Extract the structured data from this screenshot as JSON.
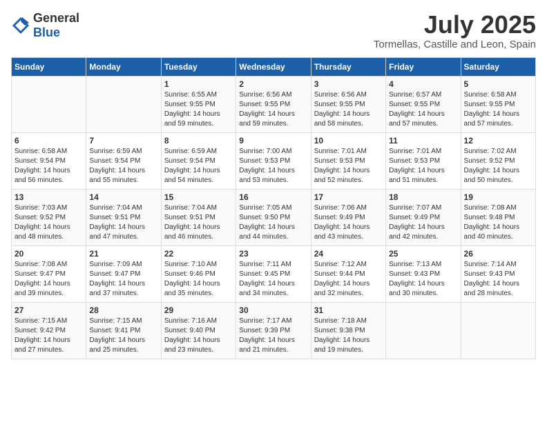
{
  "logo": {
    "general": "General",
    "blue": "Blue"
  },
  "title": "July 2025",
  "subtitle": "Tormellas, Castille and Leon, Spain",
  "days": [
    "Sunday",
    "Monday",
    "Tuesday",
    "Wednesday",
    "Thursday",
    "Friday",
    "Saturday"
  ],
  "weeks": [
    [
      {
        "day": "",
        "sunrise": "",
        "sunset": "",
        "daylight": ""
      },
      {
        "day": "",
        "sunrise": "",
        "sunset": "",
        "daylight": ""
      },
      {
        "day": "1",
        "sunrise": "Sunrise: 6:55 AM",
        "sunset": "Sunset: 9:55 PM",
        "daylight": "Daylight: 14 hours and 59 minutes."
      },
      {
        "day": "2",
        "sunrise": "Sunrise: 6:56 AM",
        "sunset": "Sunset: 9:55 PM",
        "daylight": "Daylight: 14 hours and 59 minutes."
      },
      {
        "day": "3",
        "sunrise": "Sunrise: 6:56 AM",
        "sunset": "Sunset: 9:55 PM",
        "daylight": "Daylight: 14 hours and 58 minutes."
      },
      {
        "day": "4",
        "sunrise": "Sunrise: 6:57 AM",
        "sunset": "Sunset: 9:55 PM",
        "daylight": "Daylight: 14 hours and 57 minutes."
      },
      {
        "day": "5",
        "sunrise": "Sunrise: 6:58 AM",
        "sunset": "Sunset: 9:55 PM",
        "daylight": "Daylight: 14 hours and 57 minutes."
      }
    ],
    [
      {
        "day": "6",
        "sunrise": "Sunrise: 6:58 AM",
        "sunset": "Sunset: 9:54 PM",
        "daylight": "Daylight: 14 hours and 56 minutes."
      },
      {
        "day": "7",
        "sunrise": "Sunrise: 6:59 AM",
        "sunset": "Sunset: 9:54 PM",
        "daylight": "Daylight: 14 hours and 55 minutes."
      },
      {
        "day": "8",
        "sunrise": "Sunrise: 6:59 AM",
        "sunset": "Sunset: 9:54 PM",
        "daylight": "Daylight: 14 hours and 54 minutes."
      },
      {
        "day": "9",
        "sunrise": "Sunrise: 7:00 AM",
        "sunset": "Sunset: 9:53 PM",
        "daylight": "Daylight: 14 hours and 53 minutes."
      },
      {
        "day": "10",
        "sunrise": "Sunrise: 7:01 AM",
        "sunset": "Sunset: 9:53 PM",
        "daylight": "Daylight: 14 hours and 52 minutes."
      },
      {
        "day": "11",
        "sunrise": "Sunrise: 7:01 AM",
        "sunset": "Sunset: 9:53 PM",
        "daylight": "Daylight: 14 hours and 51 minutes."
      },
      {
        "day": "12",
        "sunrise": "Sunrise: 7:02 AM",
        "sunset": "Sunset: 9:52 PM",
        "daylight": "Daylight: 14 hours and 50 minutes."
      }
    ],
    [
      {
        "day": "13",
        "sunrise": "Sunrise: 7:03 AM",
        "sunset": "Sunset: 9:52 PM",
        "daylight": "Daylight: 14 hours and 48 minutes."
      },
      {
        "day": "14",
        "sunrise": "Sunrise: 7:04 AM",
        "sunset": "Sunset: 9:51 PM",
        "daylight": "Daylight: 14 hours and 47 minutes."
      },
      {
        "day": "15",
        "sunrise": "Sunrise: 7:04 AM",
        "sunset": "Sunset: 9:51 PM",
        "daylight": "Daylight: 14 hours and 46 minutes."
      },
      {
        "day": "16",
        "sunrise": "Sunrise: 7:05 AM",
        "sunset": "Sunset: 9:50 PM",
        "daylight": "Daylight: 14 hours and 44 minutes."
      },
      {
        "day": "17",
        "sunrise": "Sunrise: 7:06 AM",
        "sunset": "Sunset: 9:49 PM",
        "daylight": "Daylight: 14 hours and 43 minutes."
      },
      {
        "day": "18",
        "sunrise": "Sunrise: 7:07 AM",
        "sunset": "Sunset: 9:49 PM",
        "daylight": "Daylight: 14 hours and 42 minutes."
      },
      {
        "day": "19",
        "sunrise": "Sunrise: 7:08 AM",
        "sunset": "Sunset: 9:48 PM",
        "daylight": "Daylight: 14 hours and 40 minutes."
      }
    ],
    [
      {
        "day": "20",
        "sunrise": "Sunrise: 7:08 AM",
        "sunset": "Sunset: 9:47 PM",
        "daylight": "Daylight: 14 hours and 39 minutes."
      },
      {
        "day": "21",
        "sunrise": "Sunrise: 7:09 AM",
        "sunset": "Sunset: 9:47 PM",
        "daylight": "Daylight: 14 hours and 37 minutes."
      },
      {
        "day": "22",
        "sunrise": "Sunrise: 7:10 AM",
        "sunset": "Sunset: 9:46 PM",
        "daylight": "Daylight: 14 hours and 35 minutes."
      },
      {
        "day": "23",
        "sunrise": "Sunrise: 7:11 AM",
        "sunset": "Sunset: 9:45 PM",
        "daylight": "Daylight: 14 hours and 34 minutes."
      },
      {
        "day": "24",
        "sunrise": "Sunrise: 7:12 AM",
        "sunset": "Sunset: 9:44 PM",
        "daylight": "Daylight: 14 hours and 32 minutes."
      },
      {
        "day": "25",
        "sunrise": "Sunrise: 7:13 AM",
        "sunset": "Sunset: 9:43 PM",
        "daylight": "Daylight: 14 hours and 30 minutes."
      },
      {
        "day": "26",
        "sunrise": "Sunrise: 7:14 AM",
        "sunset": "Sunset: 9:43 PM",
        "daylight": "Daylight: 14 hours and 28 minutes."
      }
    ],
    [
      {
        "day": "27",
        "sunrise": "Sunrise: 7:15 AM",
        "sunset": "Sunset: 9:42 PM",
        "daylight": "Daylight: 14 hours and 27 minutes."
      },
      {
        "day": "28",
        "sunrise": "Sunrise: 7:15 AM",
        "sunset": "Sunset: 9:41 PM",
        "daylight": "Daylight: 14 hours and 25 minutes."
      },
      {
        "day": "29",
        "sunrise": "Sunrise: 7:16 AM",
        "sunset": "Sunset: 9:40 PM",
        "daylight": "Daylight: 14 hours and 23 minutes."
      },
      {
        "day": "30",
        "sunrise": "Sunrise: 7:17 AM",
        "sunset": "Sunset: 9:39 PM",
        "daylight": "Daylight: 14 hours and 21 minutes."
      },
      {
        "day": "31",
        "sunrise": "Sunrise: 7:18 AM",
        "sunset": "Sunset: 9:38 PM",
        "daylight": "Daylight: 14 hours and 19 minutes."
      },
      {
        "day": "",
        "sunrise": "",
        "sunset": "",
        "daylight": ""
      },
      {
        "day": "",
        "sunrise": "",
        "sunset": "",
        "daylight": ""
      }
    ]
  ]
}
